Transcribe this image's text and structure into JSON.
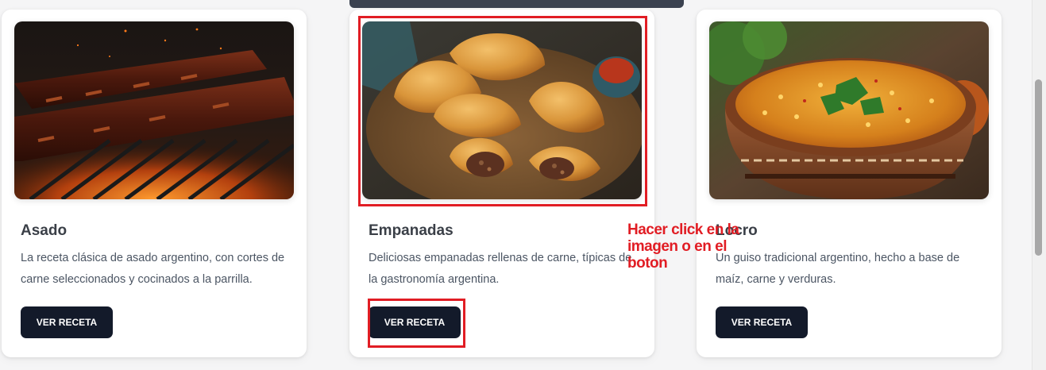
{
  "cards": [
    {
      "title": "Asado",
      "description": "La receta clásica de asado argentino, con cortes de carne seleccionados y cocinados a la parrilla.",
      "button_label": "VER RECETA",
      "image": "asado-photo"
    },
    {
      "title": "Empanadas",
      "description": "Deliciosas empanadas rellenas de carne, típicas de la gastronomía argentina.",
      "button_label": "VER RECETA",
      "image": "empanadas-photo"
    },
    {
      "title": "Locro",
      "description": "Un guiso tradicional argentino, hecho a base de maíz, carne y verduras.",
      "button_label": "VER RECETA",
      "image": "locro-photo"
    }
  ],
  "annotation": {
    "text": "Hacer click en la imagen o en el boton",
    "color": "#e11d24"
  },
  "colors": {
    "button_bg": "#131a2a",
    "button_text": "#ffffff",
    "highlight": "#e11d24"
  }
}
